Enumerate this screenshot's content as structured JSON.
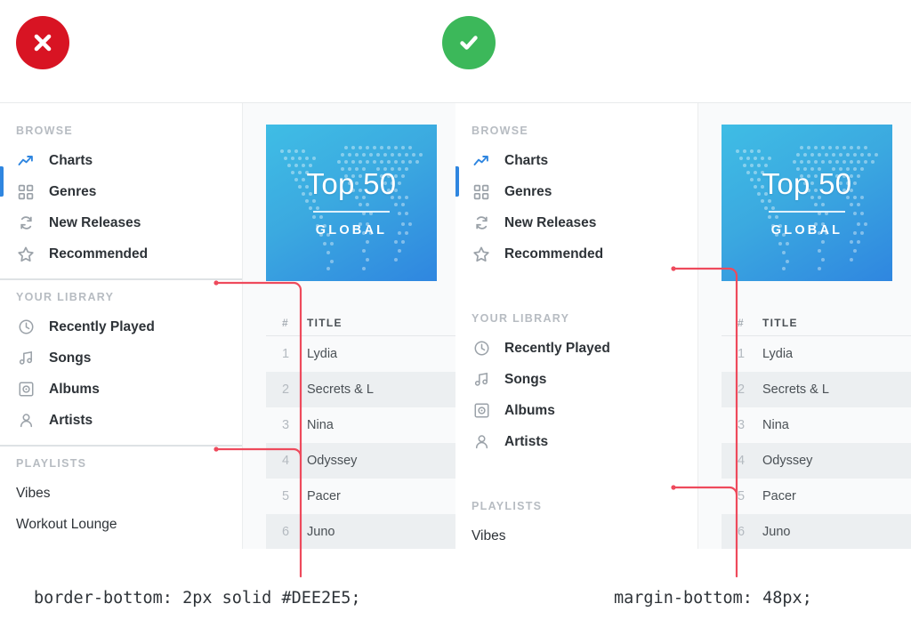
{
  "marks": {
    "bad": {
      "icon": "close-circle-icon",
      "color": "#D81423",
      "glyph": "✕"
    },
    "good": {
      "icon": "check-circle-icon",
      "color": "#3CB85A",
      "glyph": "✓"
    }
  },
  "sidebar": {
    "sections": [
      {
        "key": "browse",
        "title": "BROWSE",
        "items": [
          {
            "label": "Charts",
            "icon": "trend-up-icon",
            "active": true
          },
          {
            "label": "Genres",
            "icon": "grid-icon",
            "active": false
          },
          {
            "label": "New Releases",
            "icon": "refresh-icon",
            "active": false
          },
          {
            "label": "Recommended",
            "icon": "star-icon",
            "active": false
          }
        ]
      },
      {
        "key": "library",
        "title": "YOUR LIBRARY",
        "items": [
          {
            "label": "Recently Played",
            "icon": "clock-icon",
            "active": false
          },
          {
            "label": "Songs",
            "icon": "music-note-icon",
            "active": false
          },
          {
            "label": "Albums",
            "icon": "album-disc-icon",
            "active": false
          },
          {
            "label": "Artists",
            "icon": "person-icon",
            "active": false
          }
        ]
      },
      {
        "key": "playlists",
        "title": "PLAYLISTS",
        "items": [
          {
            "label": "Vibes",
            "icon": "",
            "active": false
          },
          {
            "label": "Workout Lounge",
            "icon": "",
            "active": false
          }
        ]
      }
    ]
  },
  "cover": {
    "title": "Top 50",
    "subtitle": "GLOBAL",
    "gradient_from": "#3FBDE5",
    "gradient_to": "#2F86E0"
  },
  "tracklist": {
    "columns": [
      "#",
      "TITLE"
    ],
    "rows": [
      {
        "num": "1",
        "title": "Lydia"
      },
      {
        "num": "2",
        "title": "Secrets & L"
      },
      {
        "num": "3",
        "title": "Nina"
      },
      {
        "num": "4",
        "title": "Odyssey"
      },
      {
        "num": "5",
        "title": "Pacer"
      },
      {
        "num": "6",
        "title": "Juno"
      }
    ]
  },
  "captions": {
    "left": "border-bottom: 2px solid #DEE2E5;",
    "right": "margin-bottom: 48px;"
  },
  "colors": {
    "accent_blue": "#2F86E0",
    "annotation_red": "#EE4A5C",
    "divider_gray": "#DEE2E5",
    "row_alt": "#ECEFF1"
  }
}
